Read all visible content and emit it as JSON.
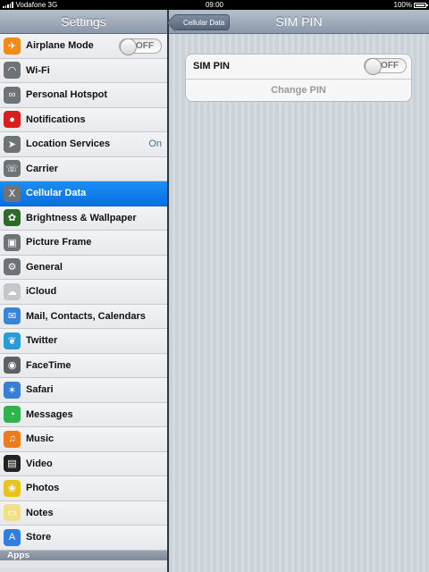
{
  "status": {
    "carrier": "Vodafone 3G",
    "time": "09:00",
    "battery": "100%"
  },
  "left": {
    "title": "Settings",
    "items": [
      {
        "label": "Airplane Mode",
        "icon": "airplane-icon",
        "color": "#f08a1a",
        "toggle": "OFF"
      },
      {
        "label": "Wi-Fi",
        "icon": "wifi-icon",
        "color": "#6e7377"
      },
      {
        "label": "Personal Hotspot",
        "icon": "link-icon",
        "color": "#6e7377"
      },
      {
        "label": "Notifications",
        "icon": "notifications-icon",
        "color": "#d91e1e"
      },
      {
        "label": "Location Services",
        "icon": "location-arrow-icon",
        "color": "#6e7377",
        "value": "On"
      },
      {
        "label": "Carrier",
        "icon": "phone-icon",
        "color": "#6e7377"
      },
      {
        "label": "Cellular Data",
        "icon": "cellular-antenna-icon",
        "color": "#6e7377",
        "selected": true
      },
      {
        "label": "Brightness & Wallpaper",
        "icon": "flower-icon",
        "color": "#2e6b2a"
      },
      {
        "label": "Picture Frame",
        "icon": "picture-frame-icon",
        "color": "#6e7377"
      },
      {
        "label": "General",
        "icon": "gear-icon",
        "color": "#6e7377"
      },
      {
        "label": "iCloud",
        "icon": "cloud-icon",
        "color": "#c3c8cd"
      },
      {
        "label": "Mail, Contacts, Calendars",
        "icon": "mail-icon",
        "color": "#3a84d8"
      },
      {
        "label": "Twitter",
        "icon": "twitter-bird-icon",
        "color": "#2a9bd8"
      },
      {
        "label": "FaceTime",
        "icon": "camera-icon",
        "color": "#5c6166"
      },
      {
        "label": "Safari",
        "icon": "compass-icon",
        "color": "#3a7fd6"
      },
      {
        "label": "Messages",
        "icon": "message-bubble-icon",
        "color": "#2fb34a"
      },
      {
        "label": "Music",
        "icon": "music-note-icon",
        "color": "#ef7a1b"
      },
      {
        "label": "Video",
        "icon": "film-icon",
        "color": "#222222"
      },
      {
        "label": "Photos",
        "icon": "sunflower-icon",
        "color": "#e8c31a"
      },
      {
        "label": "Notes",
        "icon": "notepad-icon",
        "color": "#f2df8a"
      },
      {
        "label": "Store",
        "icon": "app-store-icon",
        "color": "#2f7ee0"
      }
    ],
    "section": "Apps"
  },
  "right": {
    "back_label": "Cellular Data",
    "title": "SIM PIN",
    "sim_pin": {
      "label": "SIM PIN",
      "toggle": "OFF"
    },
    "change_pin": "Change PIN"
  }
}
